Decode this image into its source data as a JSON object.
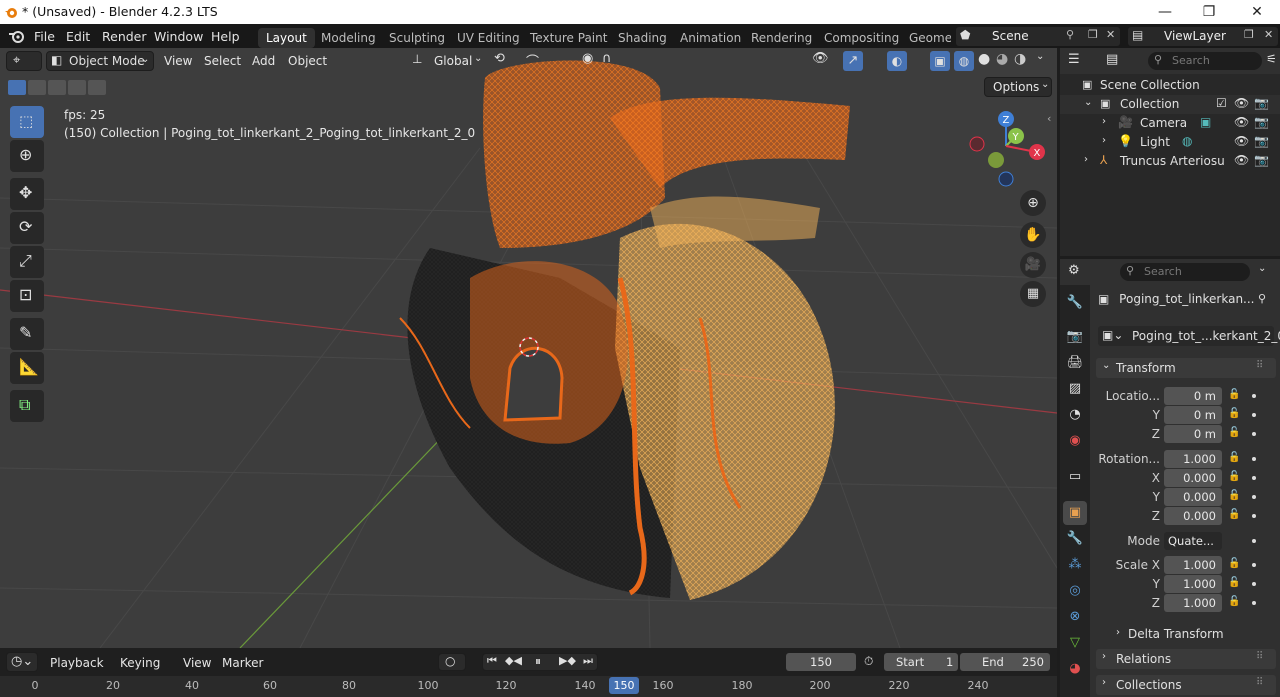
{
  "window": {
    "title": "* (Unsaved) - Blender 4.2.3 LTS"
  },
  "menubar": {
    "menus": [
      "File",
      "Edit",
      "Render",
      "Window",
      "Help"
    ],
    "workspaces": [
      "Layout",
      "Modeling",
      "Sculpting",
      "UV Editing",
      "Texture Paint",
      "Shading",
      "Animation",
      "Rendering",
      "Compositing",
      "Geomet"
    ],
    "scene": "Scene",
    "view_layer": "ViewLayer"
  },
  "viewport": {
    "mode": "Object Mode",
    "menus": [
      "View",
      "Select",
      "Add",
      "Object"
    ],
    "orientation": "Global",
    "options": "Options",
    "fps": "fps: 25",
    "info": "(150) Collection | Poging_tot_linkerkant_2_Poging_tot_linkerkant_2_0",
    "gizmo_axes": [
      "Z",
      "Y",
      "X"
    ]
  },
  "outliner": {
    "search_placeholder": "Search",
    "scene_collection": "Scene Collection",
    "collection": "Collection",
    "items": [
      "Camera",
      "Light",
      "Truncus Arteriosu"
    ]
  },
  "properties": {
    "search_placeholder": "Search",
    "object_name": "Poging_tot_linkerkan...",
    "mesh_name": "Poging_tot_...kerkant_2_0",
    "transform": {
      "title": "Transform",
      "location_label": "Locatio...",
      "location": [
        "0 m",
        "0 m",
        "0 m"
      ],
      "rotation_label": "Rotation...",
      "rotation": [
        "1.000",
        "0.000",
        "0.000",
        "0.000"
      ],
      "mode_label": "Mode",
      "mode": "Quate...",
      "scale_label": "Scale X",
      "scale": [
        "1.000",
        "1.000",
        "1.000"
      ],
      "axis_labels": [
        "Y",
        "Z",
        "X",
        "Y",
        "Z",
        "Y",
        "Z"
      ]
    },
    "sections": [
      "Delta Transform",
      "Relations",
      "Collections"
    ]
  },
  "timeline": {
    "menus": [
      "Playback",
      "Keying",
      "View",
      "Marker"
    ],
    "current_frame": "150",
    "start_label": "Start",
    "start": "1",
    "end_label": "End",
    "end": "250",
    "ruler": [
      "0",
      "20",
      "40",
      "60",
      "80",
      "100",
      "120",
      "140",
      "150",
      "160",
      "180",
      "200",
      "220",
      "240"
    ]
  },
  "colors": {
    "accent": "#4772b3",
    "wire_orange": "#e8681a",
    "wire_light": "#f0a040",
    "x_axis": "#e0344a",
    "y_axis": "#8bc34a",
    "z_axis": "#3f7fd6"
  }
}
